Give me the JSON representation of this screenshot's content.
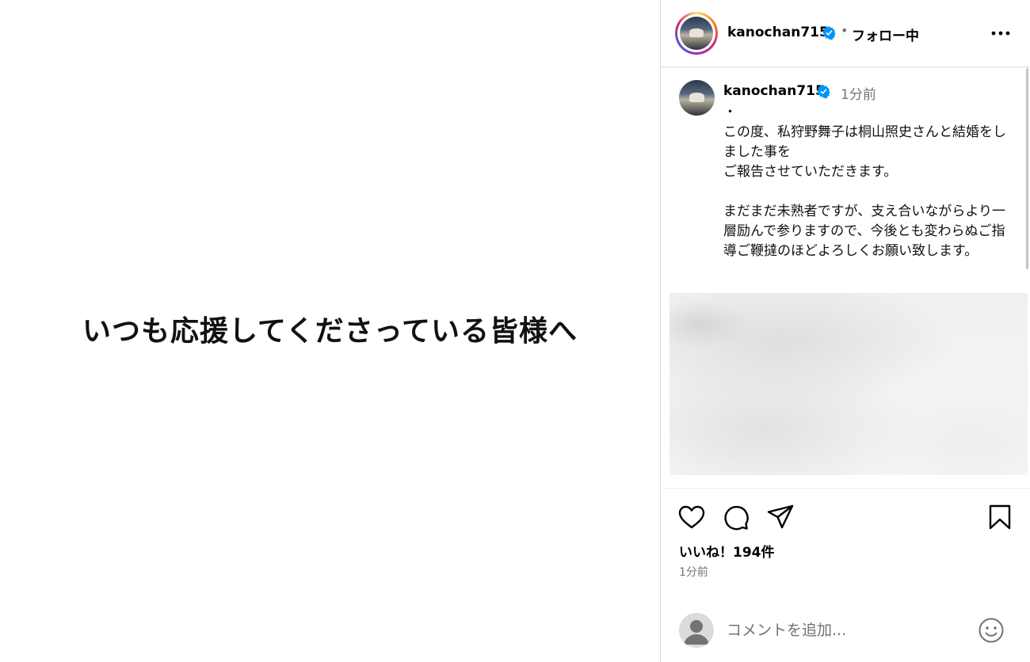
{
  "post": {
    "image_text": "いつも応援してくださっている皆様へ"
  },
  "header": {
    "username": "kanochan715",
    "separator": "•",
    "follow_label": "フォロー中"
  },
  "caption": {
    "username": "kanochan715",
    "time": "1分前",
    "text": "・\nこの度、私狩野舞子は桐山照史さんと結婚をしました事を\nご報告させていただきます。\n\nまだまだ未熟者ですが、支え合いながらより一層励んで参りますので、今後とも変わらぬご指導ご鞭撻のほどよろしくお願い致します。"
  },
  "actions": {
    "likes": "いいね！194件",
    "time": "1分前"
  },
  "comment_box": {
    "placeholder": "コメントを追加..."
  },
  "colors": {
    "verified": "#0095f6",
    "muted_text": "#737373",
    "divider": "#dbdbdb"
  },
  "icons": [
    "verified-badge-icon",
    "more-options-icon",
    "heart-icon",
    "comment-icon",
    "share-icon",
    "bookmark-icon",
    "user-placeholder-icon",
    "emoji-icon"
  ]
}
